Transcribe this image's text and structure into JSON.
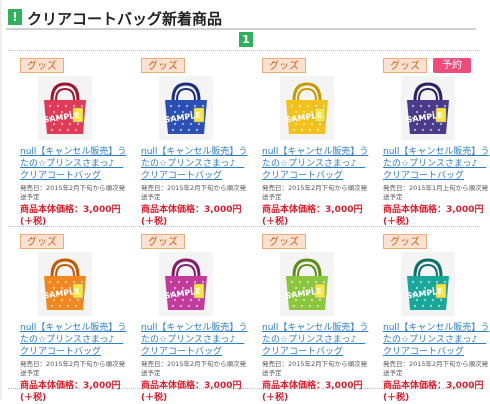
{
  "header": {
    "mark": "!",
    "title": "クリアコートバッグ新着商品"
  },
  "pager": {
    "current": "1"
  },
  "products": [
    {
      "badge": "グッズ",
      "extra_badge": "",
      "name": "null【キャンセル販売】うたの☆プリンスさまっ♪　クリアコートバッグ",
      "meta": "発売日：2015年2月下旬から順次発送予定",
      "price": "商品本体価格：3,000円(＋税)",
      "color": "#e03a57",
      "accent": "#a0162f"
    },
    {
      "badge": "グッズ",
      "extra_badge": "",
      "name": "null【キャンセル販売】うたの☆プリンスさまっ♪　クリアコートバッグ",
      "meta": "発売日：2015年2月下旬から順次発送予定",
      "price": "商品本体価格：3,000円(＋税)",
      "color": "#2a4fb5",
      "accent": "#1a2f78"
    },
    {
      "badge": "グッズ",
      "extra_badge": "",
      "name": "null【キャンセル販売】うたの☆プリンスさまっ♪　クリアコートバッグ",
      "meta": "発売日：2015年2月下旬から順次発送予定",
      "price": "商品本体価格：3,000円(＋税)",
      "color": "#f2c21b",
      "accent": "#c99a00"
    },
    {
      "badge": "グッズ",
      "extra_badge": "予約",
      "name": "null【キャンセル販売】うたの☆プリンスさまっ♪　クリアコートバッグ",
      "meta": "発売日：2015年1月上旬から順次発送予定",
      "price": "商品本体価格：3,000円(＋税)",
      "color": "#4a3a8a",
      "accent": "#2b2060"
    },
    {
      "badge": "グッズ",
      "extra_badge": "",
      "name": "null【キャンセル販売】うたの☆プリンスさまっ♪　クリアコートバッグ",
      "meta": "発売日：2015年2月下旬から順次発送予定",
      "price": "商品本体価格：3,000円(＋税)",
      "color": "#f2871e",
      "accent": "#c25a00"
    },
    {
      "badge": "グッズ",
      "extra_badge": "",
      "name": "null【キャンセル販売】うたの☆プリンスさまっ♪　クリアコートバッグ",
      "meta": "発売日：2015年2月下旬から順次発送予定",
      "price": "商品本体価格：3,000円(＋税)",
      "color": "#c23a9c",
      "accent": "#861d6a"
    },
    {
      "badge": "グッズ",
      "extra_badge": "",
      "name": "null【キャンセル販売】うたの☆プリンスさまっ♪　クリアコートバッグ",
      "meta": "発売日：2015年2月下旬から順次発送予定",
      "price": "商品本体価格：3,000円(＋税)",
      "color": "#8cc63e",
      "accent": "#5c8f1a"
    },
    {
      "badge": "グッズ",
      "extra_badge": "",
      "name": "null【キャンセル販売】うたの☆プリンスさまっ♪　クリアコートバッグ",
      "meta": "発売日：2015年2月下旬から順次発送予定",
      "price": "商品本体価格：3,000円(＋税)",
      "color": "#18a89a",
      "accent": "#0b6f66"
    }
  ],
  "image_text": "SAMPLE"
}
